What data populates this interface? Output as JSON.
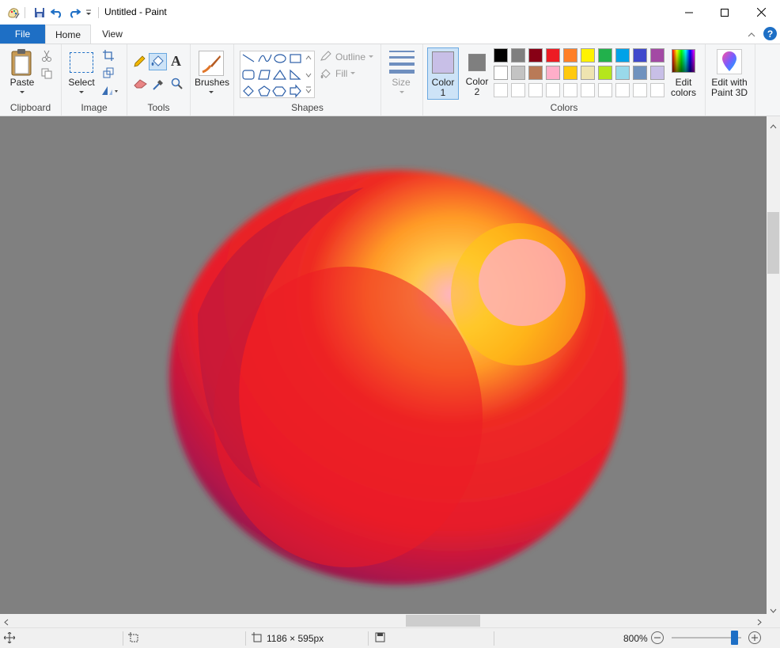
{
  "window": {
    "title": "Untitled - Paint"
  },
  "tabs": {
    "file": "File",
    "home": "Home",
    "view": "View"
  },
  "ribbon": {
    "clipboard": {
      "label": "Clipboard",
      "paste": "Paste"
    },
    "image": {
      "label": "Image",
      "select": "Select"
    },
    "tools": {
      "label": "Tools"
    },
    "brushes": {
      "label": "Brushes"
    },
    "shapes": {
      "label": "Shapes",
      "outline": "Outline",
      "fill": "Fill"
    },
    "size": {
      "label": "Size"
    },
    "colors": {
      "label": "Colors",
      "color1_line1": "Color",
      "color1_line2": "1",
      "color2_line1": "Color",
      "color2_line2": "2",
      "edit_line1": "Edit",
      "edit_line2": "colors",
      "color1_value": "#c8bfe7",
      "color2_value": "#7f7f7f",
      "palette_row1": [
        "#000000",
        "#7f7f7f",
        "#880015",
        "#ed1c24",
        "#ff7f27",
        "#fff200",
        "#22b14c",
        "#00a2e8",
        "#3f48cc",
        "#a349a4"
      ],
      "palette_row2": [
        "#ffffff",
        "#c3c3c3",
        "#b97a57",
        "#ffaec9",
        "#ffc90e",
        "#efe4b0",
        "#b5e61d",
        "#99d9ea",
        "#7092be",
        "#c8bfe7"
      ]
    },
    "paint3d": {
      "line1": "Edit with",
      "line2": "Paint 3D"
    }
  },
  "status": {
    "canvas_size": "1186 × 595px",
    "zoom": "800%",
    "zoom_level": 0.9
  },
  "canvas": {
    "background": "#808080",
    "image_description_colors": [
      "#ed1c24",
      "#ff7f27",
      "#ffc90e",
      "#ffaec9",
      "#b0164a"
    ]
  }
}
